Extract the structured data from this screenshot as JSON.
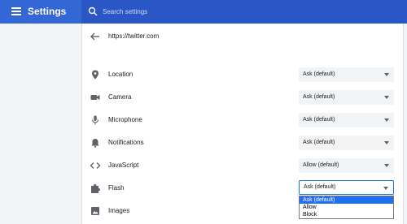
{
  "app": {
    "title": "Settings"
  },
  "search": {
    "placeholder": "Search settings"
  },
  "site": {
    "url": "https://twitter.com"
  },
  "permissions": [
    {
      "label": "Location",
      "value": "Ask (default)",
      "icon": "location-pin-icon"
    },
    {
      "label": "Camera",
      "value": "Ask (default)",
      "icon": "camera-icon"
    },
    {
      "label": "Microphone",
      "value": "Ask (default)",
      "icon": "microphone-icon"
    },
    {
      "label": "Notifications",
      "value": "Ask (default)",
      "icon": "bell-icon"
    },
    {
      "label": "JavaScript",
      "value": "Allow (default)",
      "icon": "code-icon"
    },
    {
      "label": "Flash",
      "value": "Ask (default)",
      "icon": "puzzle-icon"
    },
    {
      "label": "Images",
      "value": "",
      "icon": "image-icon"
    }
  ],
  "flash_dropdown": {
    "options": [
      "Ask (default)",
      "Allow",
      "Block"
    ],
    "highlighted": "Ask (default)"
  },
  "colors": {
    "topbar": "#3367d6",
    "search": "#2a56c6",
    "accent": "#1a73e8",
    "highlight": "#1e70f0"
  }
}
